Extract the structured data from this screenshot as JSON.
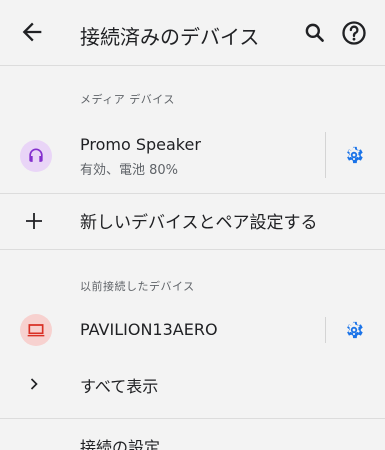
{
  "appbar": {
    "back_icon": "arrow-back-icon",
    "title": "接続済みのデバイス",
    "search_icon": "search-icon",
    "help_icon": "help-icon"
  },
  "media_section": {
    "header": "メディア デバイス",
    "device": {
      "name": "Promo Speaker",
      "status": "有効、電池 80%",
      "icon": "headset-icon",
      "settings_icon": "gear-icon"
    }
  },
  "pair_new": {
    "icon": "plus-icon",
    "label": "新しいデバイスとペア設定する"
  },
  "previous_section": {
    "header": "以前接続したデバイス",
    "device": {
      "name": "PAVILION13AERO",
      "icon": "laptop-icon",
      "settings_icon": "gear-icon"
    }
  },
  "show_all": {
    "icon": "chevron-right-icon",
    "label": "すべて表示"
  },
  "connection_prefs": {
    "label": "接続の設定"
  },
  "colors": {
    "accent": "#1a73e8",
    "headset_bg": "#e9d5f7",
    "headset_fg": "#8430ce",
    "laptop_bg": "#f7d1cf",
    "laptop_fg": "#d93025"
  }
}
